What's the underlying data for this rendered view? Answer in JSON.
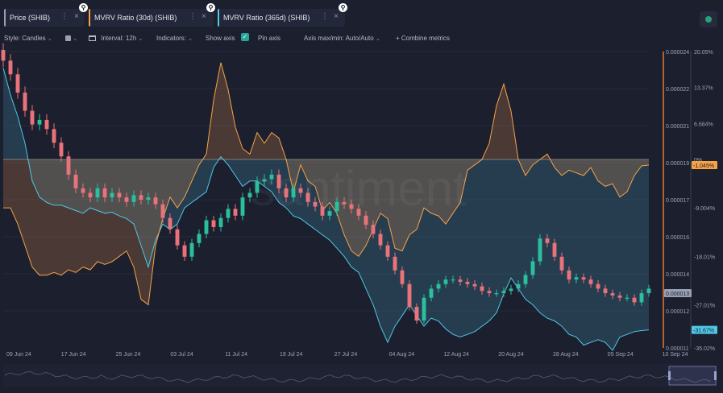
{
  "tabs": [
    {
      "label": "Price (SHIB)",
      "color": "#9aa0b4"
    },
    {
      "label": "MVRV Ratio (30d) (SHIB)",
      "color": "#f6a347"
    },
    {
      "label": "MVRV Ratio (365d) (SHIB)",
      "color": "#4fc7e6"
    }
  ],
  "tab_close": "×",
  "tab_menu": "⋮",
  "tab_badge": "⚲",
  "toolbar": {
    "style": "Style: Candles",
    "interval": "Interval: 12h",
    "indicators": "Indicators:",
    "show_axis": "Show axis",
    "check": "✓",
    "pin_axis": "Pin axis",
    "axis_maxmin": "Axis max/min: Auto/Auto",
    "combine": "Combine metrics",
    "chevron": "⌄",
    "plus": "+"
  },
  "watermark": "santiment",
  "chart_data": {
    "type": "line",
    "x_labels": [
      "09 Jun 24",
      "17 Jun 24",
      "25 Jun 24",
      "03 Jul 24",
      "11 Jul 24",
      "19 Jul 24",
      "27 Jul 24",
      "04 Aug 24",
      "12 Aug 24",
      "20 Aug 24",
      "28 Aug 24",
      "05 Sep 24",
      "10 Sep 24"
    ],
    "price_axis": {
      "ticks": [
        "0.000024",
        "0.000022",
        "0.000021",
        "0.000019",
        "0.000017",
        "0.000016",
        "0.000014",
        "0.000012",
        "0.000011"
      ],
      "current": "0.000013",
      "current_value": 1.34e-05
    },
    "mvrv_axis": {
      "ticks": [
        "20.05%",
        "13.37%",
        "6.684%",
        "0%",
        "-9.004%",
        "-18.01%",
        "-27.01%",
        "-35.02%"
      ],
      "mvrv30_current": "-1.045%",
      "mvrv365_current": "-31.67%"
    },
    "series": [
      {
        "name": "Price (SHIB)",
        "color_up": "#2bbf9e",
        "color_down": "#e8737b",
        "close": [
          2.36e-05,
          2.3e-05,
          2.22e-05,
          2.14e-05,
          2.08e-05,
          2.1e-05,
          2.06e-05,
          2e-05,
          1.94e-05,
          1.86e-05,
          1.8e-05,
          1.78e-05,
          1.76e-05,
          1.8e-05,
          1.76e-05,
          1.78e-05,
          1.76e-05,
          1.74e-05,
          1.77e-05,
          1.75e-05,
          1.76e-05,
          1.73e-05,
          1.67e-05,
          1.62e-05,
          1.55e-05,
          1.5e-05,
          1.56e-05,
          1.6e-05,
          1.66e-05,
          1.63e-05,
          1.67e-05,
          1.71e-05,
          1.68e-05,
          1.76e-05,
          1.78e-05,
          1.83e-05,
          1.84e-05,
          1.86e-05,
          1.8e-05,
          1.76e-05,
          1.8e-05,
          1.78e-05,
          1.74e-05,
          1.72e-05,
          1.68e-05,
          1.7e-05,
          1.74e-05,
          1.73e-05,
          1.71e-05,
          1.68e-05,
          1.64e-05,
          1.6e-05,
          1.55e-05,
          1.5e-05,
          1.44e-05,
          1.38e-05,
          1.28e-05,
          1.22e-05,
          1.32e-05,
          1.36e-05,
          1.38e-05,
          1.4e-05,
          1.4e-05,
          1.39e-05,
          1.38e-05,
          1.37e-05,
          1.35e-05,
          1.34e-05,
          1.34e-05,
          1.35e-05,
          1.36e-05,
          1.38e-05,
          1.42e-05,
          1.48e-05,
          1.58e-05,
          1.56e-05,
          1.5e-05,
          1.44e-05,
          1.4e-05,
          1.41e-05,
          1.4e-05,
          1.38e-05,
          1.36e-05,
          1.34e-05,
          1.33e-05,
          1.32e-05,
          1.32e-05,
          1.3e-05,
          1.34e-05,
          1.36e-05
        ]
      },
      {
        "name": "MVRV Ratio (30d) (SHIB)",
        "color": "#f6a347",
        "values": [
          -9.0,
          -9.0,
          -12.0,
          -16.0,
          -20.0,
          -21.5,
          -21.5,
          -21.0,
          -21.5,
          -20.5,
          -21.0,
          -20.0,
          -20.5,
          -19.0,
          -19.5,
          -19.0,
          -18.0,
          -17.0,
          -20.0,
          -26.0,
          -27.0,
          -16.0,
          -11.0,
          -7.0,
          -9.0,
          -7.0,
          -4.0,
          -1.0,
          1.0,
          11.0,
          18.0,
          13.0,
          6.0,
          2.0,
          1.0,
          5.0,
          3.0,
          5.0,
          4.0,
          0.0,
          -6.0,
          -1.0,
          -4.0,
          -5.0,
          -9.5,
          -8.0,
          -10.0,
          -14.0,
          -17.0,
          -18.0,
          -16.0,
          -13.0,
          -10.0,
          -11.0,
          -16.5,
          -17.0,
          -14.0,
          -13.0,
          -9.0,
          -10.0,
          -10.5,
          -12.0,
          -10.0,
          -8.0,
          -2.0,
          -1.0,
          0.0,
          3.0,
          10.0,
          14.0,
          9.0,
          0.0,
          -3.0,
          -1.0,
          0.0,
          1.0,
          -1.5,
          -3.0,
          -2.0,
          -2.5,
          -3.0,
          -1.5,
          -4.0,
          -5.0,
          -4.5,
          -7.0,
          -6.0,
          -3.0,
          -1.2,
          -1.045
        ]
      },
      {
        "name": "MVRV Ratio (365d) (SHIB)",
        "color": "#4fc7e6",
        "values": [
          17.0,
          12.0,
          8.0,
          3.0,
          -4.0,
          -7.0,
          -8.0,
          -8.5,
          -8.5,
          -9.0,
          -9.5,
          -10.0,
          -9.0,
          -9.5,
          -10.0,
          -9.8,
          -10.5,
          -11.0,
          -12.0,
          -16.0,
          -20.0,
          -15.0,
          -12.0,
          -13.0,
          -12.0,
          -9.0,
          -8.0,
          -7.0,
          -6.0,
          -1.5,
          0.5,
          -1.0,
          -3.0,
          -5.0,
          -4.0,
          -4.0,
          -5.0,
          -6.0,
          -8.0,
          -9.0,
          -10.5,
          -11.0,
          -12.0,
          -13.0,
          -14.0,
          -15.0,
          -16.5,
          -18.0,
          -20.0,
          -21.0,
          -24.0,
          -27.0,
          -31.0,
          -34.0,
          -31.0,
          -29.0,
          -27.0,
          -29.0,
          -31.0,
          -29.5,
          -30.0,
          -31.5,
          -32.5,
          -33.0,
          -32.5,
          -32.0,
          -31.0,
          -30.0,
          -28.5,
          -25.0,
          -22.0,
          -24.0,
          -26.0,
          -27.0,
          -28.5,
          -29.5,
          -30.0,
          -31.0,
          -32.5,
          -33.0,
          -34.5,
          -34.0,
          -33.5,
          -34.0,
          -35.5,
          -33.0,
          -32.5,
          -32.0,
          -31.8,
          -31.67
        ]
      }
    ],
    "grid": true,
    "legend": "top-left"
  }
}
